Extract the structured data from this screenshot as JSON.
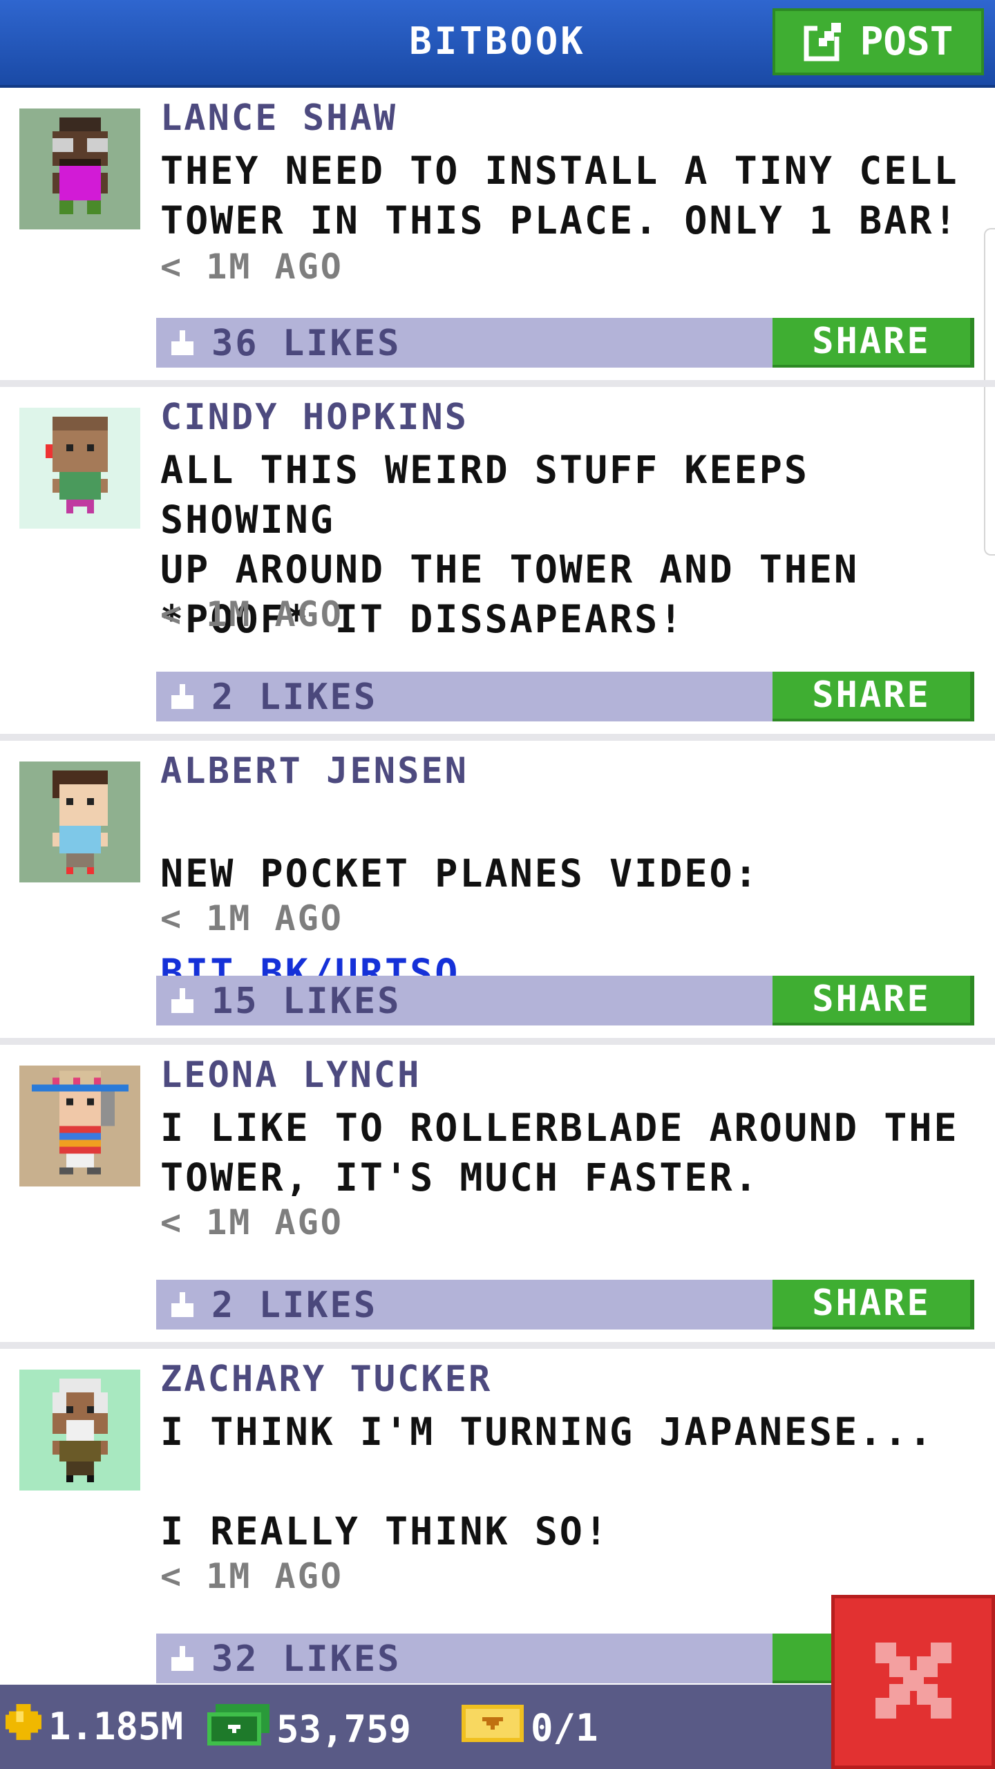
{
  "header": {
    "title": "BITBOOK",
    "post_label": "POST"
  },
  "posts": [
    {
      "author": "LANCE SHAW",
      "text": "THEY NEED TO INSTALL A TINY CELL\nTOWER IN THIS PLACE. ONLY 1 BAR!",
      "time": "< 1M AGO",
      "likes": "36 LIKES",
      "share": "SHARE"
    },
    {
      "author": "CINDY HOPKINS",
      "text": "ALL THIS WEIRD STUFF KEEPS SHOWING\nUP AROUND THE TOWER AND THEN\n*POOF* IT DISSAPEARS!",
      "time": "< 1M AGO",
      "likes": "2 LIKES",
      "share": "SHARE"
    },
    {
      "author": "ALBERT JENSEN",
      "text": "NEW POCKET PLANES VIDEO:",
      "link": "BIT.BK/URTSQ",
      "time": "< 1M AGO",
      "likes": "15 LIKES",
      "share": "SHARE"
    },
    {
      "author": "LEONA LYNCH",
      "text": "I LIKE TO ROLLERBLADE AROUND THE\nTOWER, IT'S MUCH FASTER.",
      "time": "< 1M AGO",
      "likes": "2 LIKES",
      "share": "SHARE"
    },
    {
      "author": "ZACHARY TUCKER",
      "text": "I THINK I'M TURNING JAPANESE...\n\nI REALLY THINK SO!",
      "time": "< 1M AGO",
      "likes": "32 LIKES",
      "share": "S"
    }
  ],
  "bottom_bar": {
    "coins": "1.185M",
    "bux": "53,759",
    "tickets": "0/1"
  },
  "colors": {
    "header_blue": "#2553b8",
    "button_green": "#3fae32",
    "likes_bar": "#b3b3d8",
    "close_red": "#e23131"
  }
}
